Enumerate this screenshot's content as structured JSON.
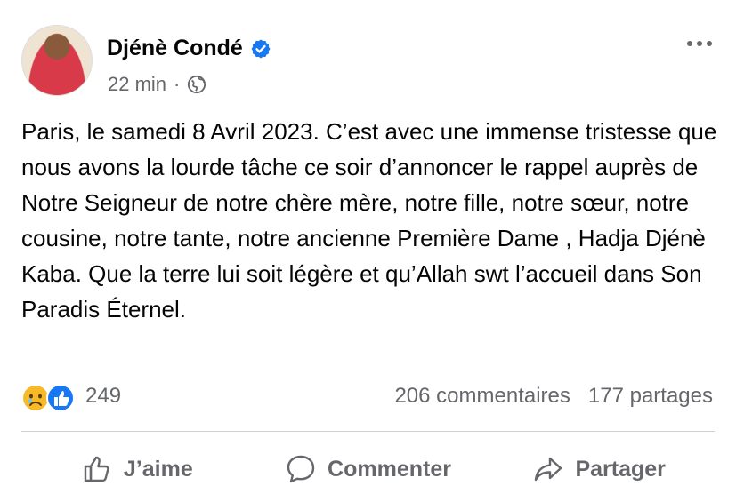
{
  "post": {
    "author": "Djénè Condé",
    "verified": true,
    "timestamp": "22 min",
    "separator": "·",
    "audience_icon": "globe-icon",
    "text": "Paris, le samedi 8 Avril 2023. C’est avec une immense tristesse que nous avons la lourde tâche ce soir d’annoncer le rappel auprès de Notre Seigneur de notre chère mère, notre fille, notre sœur, notre cousine, notre tante, notre ancienne Première Dame , Hadja Djénè Kaba. Que la terre lui soit légère et qu’Allah swt l’accueil dans Son Paradis Éternel."
  },
  "reactions": {
    "icons": [
      "sad-face-icon",
      "like-icon"
    ],
    "count": "249",
    "comments": "206 commentaires",
    "shares": "177 partages"
  },
  "actions": {
    "like": "J’aime",
    "comment": "Commenter",
    "share": "Partager"
  },
  "colors": {
    "verified": "#1877f2",
    "muted": "#65676b",
    "like_blue": "#1877f2",
    "sad_yellow": "#f7b928"
  }
}
